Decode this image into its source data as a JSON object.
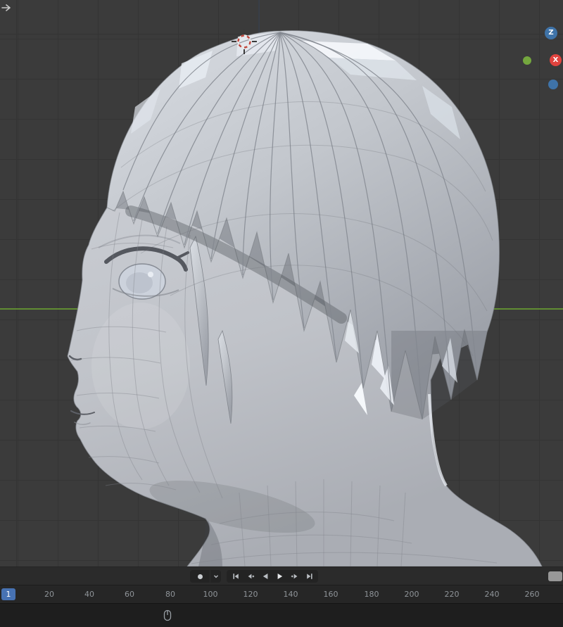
{
  "colors": {
    "accent_blue": "#4772B3",
    "axis_green": "#6CA332",
    "gizmo_z_blue": "#3F73A8",
    "gizmo_x_red": "#E0433E",
    "gizmo_green": "#74A73E",
    "viewport_bg": "#3B3B3B"
  },
  "viewport": {
    "gizmo": {
      "z_label": "Z",
      "x_label": "X",
      "icons": [
        "z-axis-ball",
        "x-axis-ball",
        "y-axis-ball-green",
        "axis-ball-blue"
      ]
    },
    "cursor_icon": "3d-cursor",
    "corner_icon": "collapse-arrow",
    "model": "anime-head-mesh-side-view"
  },
  "transport": {
    "icons": [
      "auto-key-record",
      "dropdown-chevron",
      "jump-to-start",
      "previous-keyframe",
      "play-reverse",
      "play",
      "next-keyframe",
      "jump-to-end"
    ]
  },
  "timeline": {
    "current_frame": "1",
    "ticks": [
      "20",
      "40",
      "60",
      "80",
      "100",
      "120",
      "140",
      "160",
      "180",
      "200",
      "220",
      "240",
      "260"
    ]
  },
  "statusbar": {
    "icon": "mouse-drag"
  }
}
